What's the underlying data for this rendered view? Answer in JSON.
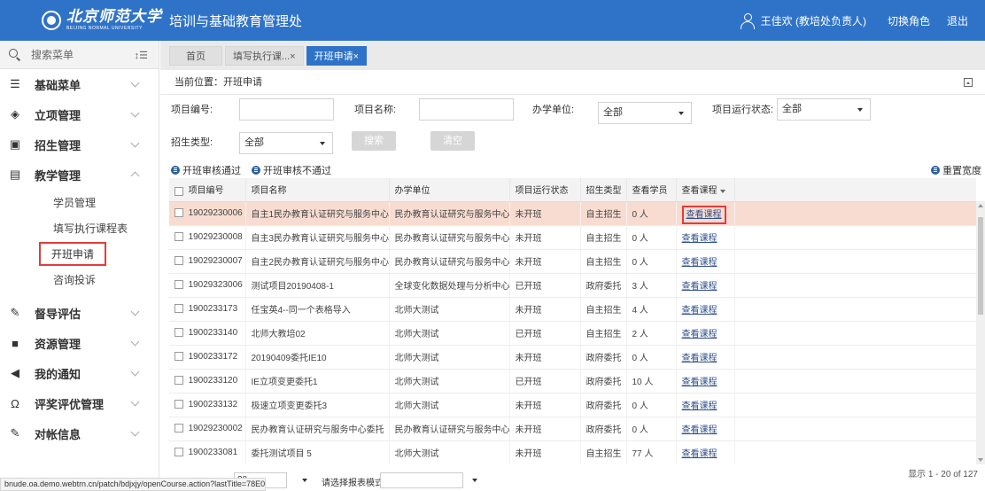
{
  "header": {
    "logo_cn": "北京师范大学",
    "logo_en": "BEIJING NORMAL UNIVERSITY",
    "dept": "培训与基础教育管理处",
    "user": "王佳欢 (教培处负责人)",
    "switch_role": "切换角色",
    "logout": "退出"
  },
  "sidebar": {
    "search_label": "搜索菜单",
    "groups": [
      {
        "label": "基础菜单",
        "icon": "list-icon"
      },
      {
        "label": "立项管理",
        "icon": "layers-icon"
      },
      {
        "label": "招生管理",
        "icon": "id-card-icon"
      },
      {
        "label": "教学管理",
        "icon": "book-icon"
      },
      {
        "label": "督导评估",
        "icon": "pen-icon"
      },
      {
        "label": "资源管理",
        "icon": "folder-icon"
      },
      {
        "label": "我的通知",
        "icon": "speaker-icon"
      },
      {
        "label": "评奖评优管理",
        "icon": "award-icon"
      },
      {
        "label": "对帐信息",
        "icon": "pen-icon"
      }
    ],
    "sub_items": [
      "学员管理",
      "填写执行课程表",
      "开班申请",
      "咨询投诉"
    ]
  },
  "tabs": [
    "首页",
    "填写执行课...×",
    "开班申请×"
  ],
  "breadcrumb": "当前位置：开班申请",
  "filters": {
    "project_no_label": "项目编号:",
    "project_name_label": "项目名称:",
    "school_unit_label": "办学单位:",
    "school_unit_value": "全部",
    "run_status_label": "项目运行状态:",
    "run_status_value": "全部",
    "enroll_type_label": "招生类型:",
    "enroll_type_value": "全部",
    "search_btn": "搜索",
    "clear_btn": "清空"
  },
  "actions": {
    "approve": "开班审核通过",
    "reject": "开班审核不通过",
    "reset_width": "重置宽度"
  },
  "table": {
    "columns": [
      "项目编号",
      "项目名称",
      "办学单位",
      "项目运行状态",
      "招生类型",
      "查看学员",
      "查看课程"
    ],
    "rows": [
      {
        "no": "19029230006",
        "name": "自主1民办教育认证研究与服务中心",
        "unit": "民办教育认证研究与服务中心",
        "status": "未开班",
        "type": "自主招生",
        "students": "0 人",
        "course": "查看课程"
      },
      {
        "no": "19029230008",
        "name": "自主3民办教育认证研究与服务中心",
        "unit": "民办教育认证研究与服务中心",
        "status": "未开班",
        "type": "自主招生",
        "students": "0 人",
        "course": "查看课程"
      },
      {
        "no": "19029230007",
        "name": "自主2民办教育认证研究与服务中心",
        "unit": "民办教育认证研究与服务中心",
        "status": "未开班",
        "type": "自主招生",
        "students": "0 人",
        "course": "查看课程"
      },
      {
        "no": "19029323006",
        "name": "测试项目20190408-1",
        "unit": "全球变化数据处理与分析中心",
        "status": "已开班",
        "type": "政府委托",
        "students": "3 人",
        "course": "查看课程"
      },
      {
        "no": "1900233173",
        "name": "任宝英4--同一个表格导入",
        "unit": "北师大测试",
        "status": "未开班",
        "type": "自主招生",
        "students": "4 人",
        "course": "查看课程"
      },
      {
        "no": "1900233140",
        "name": "北师大教培02",
        "unit": "北师大测试",
        "status": "已开班",
        "type": "自主招生",
        "students": "2 人",
        "course": "查看课程"
      },
      {
        "no": "1900233172",
        "name": "20190409委托IE10",
        "unit": "北师大测试",
        "status": "未开班",
        "type": "政府委托",
        "students": "0 人",
        "course": "查看课程"
      },
      {
        "no": "1900233120",
        "name": "IE立项变更委托1",
        "unit": "北师大测试",
        "status": "已开班",
        "type": "政府委托",
        "students": "10 人",
        "course": "查看课程"
      },
      {
        "no": "1900233132",
        "name": "极速立项变更委托3",
        "unit": "北师大测试",
        "status": "未开班",
        "type": "政府委托",
        "students": "0 人",
        "course": "查看课程"
      },
      {
        "no": "19029230002",
        "name": "民办教育认证研究与服务中心委托",
        "unit": "民办教育认证研究与服务中心",
        "status": "未开班",
        "type": "政府委托",
        "students": "0 人",
        "course": "查看课程"
      },
      {
        "no": "1900233081",
        "name": "委托测试项目 5",
        "unit": "北师大测试",
        "status": "未开班",
        "type": "自主招生",
        "students": "77 人",
        "course": "查看课程"
      }
    ]
  },
  "footer": {
    "page_size": "20",
    "format_label": "请选择报表模式",
    "page_info": "显示 1 - 20 of 127"
  },
  "statusbar": "bnude.oa.demo.webtrn.cn/patch/bdjxjy/openCourse.action?lastTitle=78E08B8F0B23D..."
}
